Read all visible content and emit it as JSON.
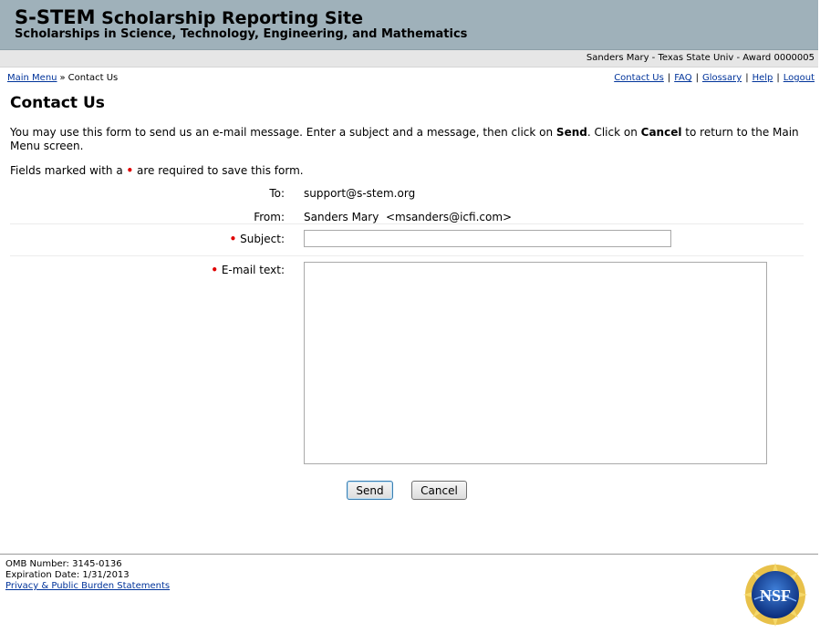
{
  "header": {
    "title_abbr": "S-STEM",
    "title_rest": "Scholarship Reporting Site",
    "subtitle": "Scholarships in Science, Technology, Engineering, and Mathematics"
  },
  "user_bar": {
    "user_info": "Sanders Mary - Texas State Univ - Award 0000005"
  },
  "breadcrumb": {
    "main_menu": "Main Menu",
    "separator": "»",
    "current": "Contact Us"
  },
  "top_links": {
    "contact_us": "Contact Us",
    "faq": "FAQ",
    "glossary": "Glossary",
    "help": "Help",
    "logout": "Logout",
    "separator": "|"
  },
  "page": {
    "title": "Contact Us",
    "intro_part1": "You may use this form to send us an e-mail message. Enter a subject and a message, then click on ",
    "intro_send": "Send",
    "intro_part2": ". Click on ",
    "intro_cancel": "Cancel",
    "intro_part3": " to return to the Main Menu screen.",
    "required_prefix": "Fields marked with a ",
    "required_dot": "•",
    "required_suffix": " are required to save this form."
  },
  "form": {
    "to_label": "To:",
    "to_value": "support@s-stem.org",
    "from_label": "From:",
    "from_value": "Sanders Mary  <msanders@icfi.com>",
    "subject_label": "Subject:",
    "subject_value": "",
    "email_text_label": "E-mail text:",
    "email_text_value": "",
    "required_marker": "•"
  },
  "buttons": {
    "send": "Send",
    "cancel": "Cancel"
  },
  "footer": {
    "omb_number": "OMB Number: 3145-0136",
    "expiration": "Expiration Date: 1/31/2013",
    "privacy_link": "Privacy & Public Burden Statements",
    "logo_text": "NSF"
  },
  "colors": {
    "header_bg": "#9fb1ba",
    "link": "#00339a",
    "required_dot": "#e00000"
  }
}
